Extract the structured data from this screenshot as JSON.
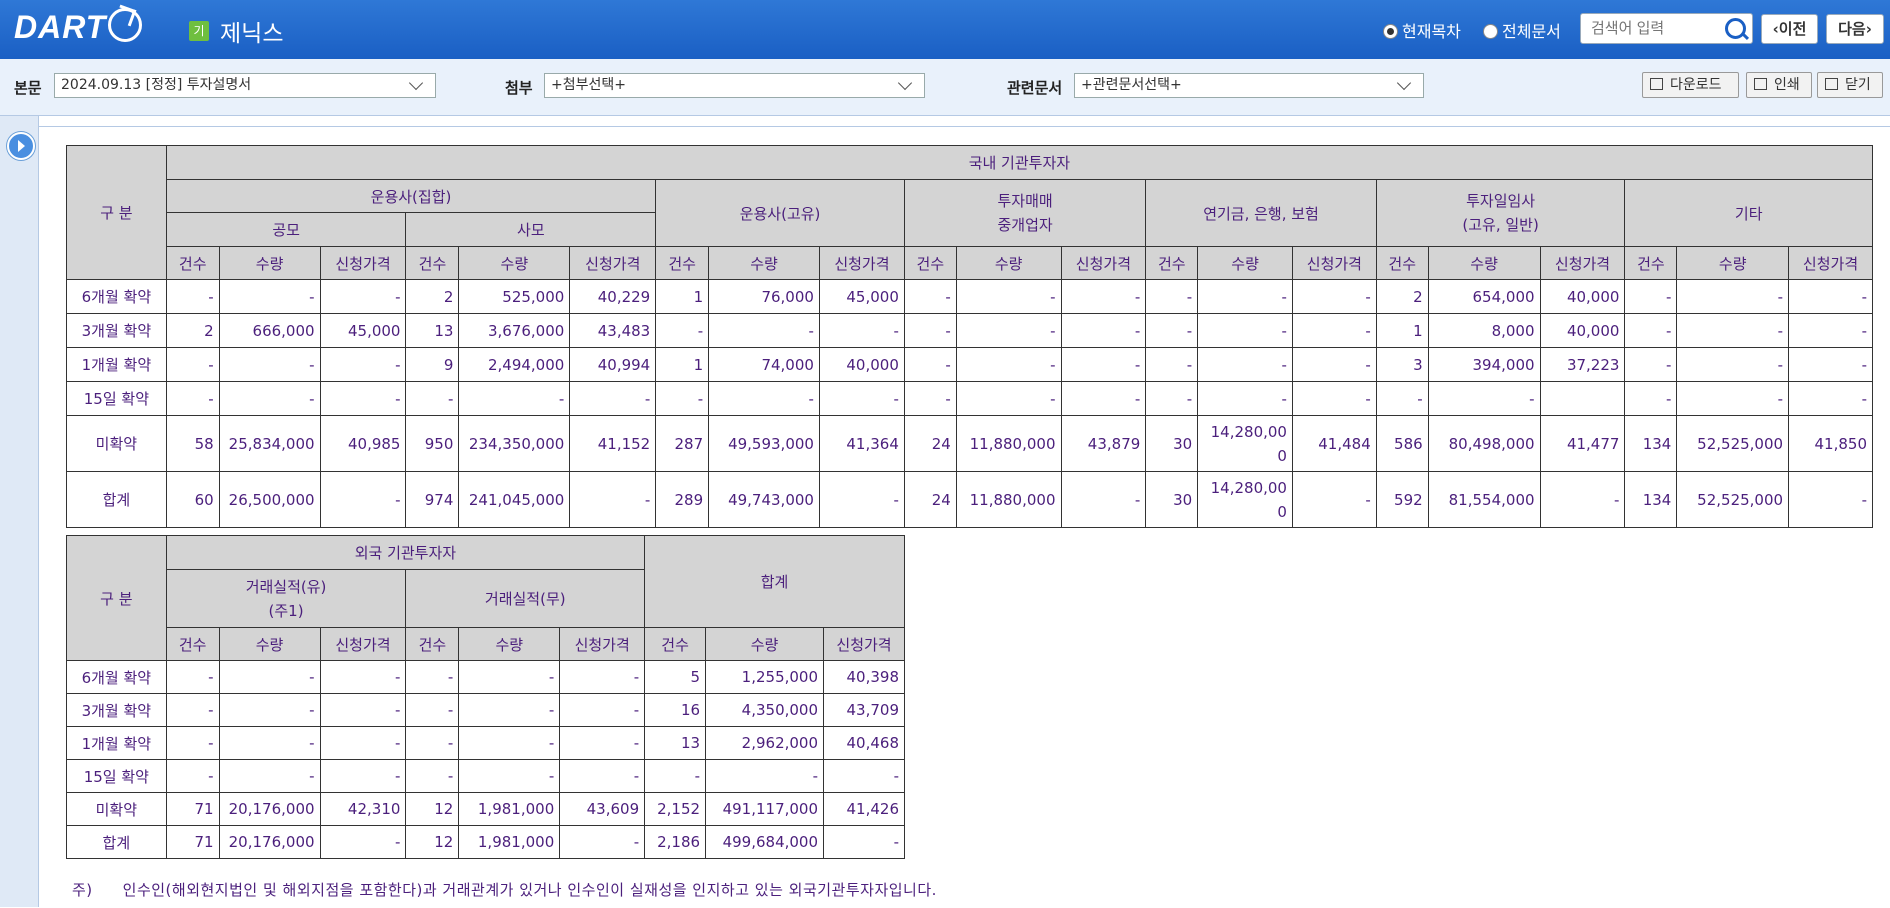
{
  "header": {
    "logo": "DART",
    "company_badge": "기",
    "company_name": "제닉스",
    "radio_current": "현재목차",
    "radio_all": "전체문서",
    "search_placeholder": "검색어 입력",
    "prev_label": "이전",
    "next_label": "다음"
  },
  "docbar": {
    "main_label": "본문",
    "main_value": "2024.09.13  [정정] 투자설명서",
    "attach_label": "첨부",
    "attach_value": "+첨부선택+",
    "related_label": "관련문서",
    "related_value": "+관련문서선택+",
    "download_label": "다운로드",
    "print_label": "인쇄",
    "close_label": "닫기"
  },
  "domestic": {
    "corner": "구 분",
    "group_title": "국내 기관투자자",
    "g1": "운용사(집합)",
    "g1a": "공모",
    "g1b": "사모",
    "g2": "운용사(고유)",
    "g3": "투자매매\n중개업자",
    "g4": "연기금, 은행, 보험",
    "g5": "투자일임사\n(고유, 일반)",
    "g6": "기타",
    "sub_cnt": "건수",
    "sub_qty": "수량",
    "sub_price": "신청가격",
    "rows": [
      {
        "label": "6개월 확약",
        "v": [
          "-",
          "-",
          "-",
          "2",
          "525,000",
          "40,229",
          "1",
          "76,000",
          "45,000",
          "-",
          "-",
          "-",
          "-",
          "-",
          "-",
          "2",
          "654,000",
          "40,000",
          "-",
          "-",
          "-"
        ]
      },
      {
        "label": "3개월 확약",
        "v": [
          "2",
          "666,000",
          "45,000",
          "13",
          "3,676,000",
          "43,483",
          "-",
          "-",
          "-",
          "-",
          "-",
          "-",
          "-",
          "-",
          "-",
          "1",
          "8,000",
          "40,000",
          "-",
          "-",
          "-"
        ]
      },
      {
        "label": "1개월 확약",
        "v": [
          "-",
          "-",
          "-",
          "9",
          "2,494,000",
          "40,994",
          "1",
          "74,000",
          "40,000",
          "-",
          "-",
          "-",
          "-",
          "-",
          "-",
          "3",
          "394,000",
          "37,223",
          "-",
          "-",
          "-"
        ]
      },
      {
        "label": "15일 확약",
        "v": [
          "-",
          "-",
          "-",
          "-",
          "-",
          "-",
          "-",
          "-",
          "-",
          "-",
          "-",
          "-",
          "-",
          "-",
          "-",
          "-",
          "-",
          "",
          "-",
          "-",
          "-"
        ]
      },
      {
        "label": "미확약",
        "v": [
          "58",
          "25,834,000",
          "40,985",
          "950",
          "234,350,000",
          "41,152",
          "287",
          "49,593,000",
          "41,364",
          "24",
          "11,880,000",
          "43,879",
          "30",
          "14,280,000",
          "41,484",
          "586",
          "80,498,000",
          "41,477",
          "134",
          "52,525,000",
          "41,850"
        ]
      },
      {
        "label": "합계",
        "v": [
          "60",
          "26,500,000",
          "-",
          "974",
          "241,045,000",
          "-",
          "289",
          "49,743,000",
          "-",
          "24",
          "11,880,000",
          "-",
          "30",
          "14,280,000",
          "-",
          "592",
          "81,554,000",
          "-",
          "134",
          "52,525,000",
          "-"
        ]
      }
    ]
  },
  "foreign": {
    "corner": "구 분",
    "group_title": "외국 기관투자자",
    "g1": "거래실적(유)\n(주1)",
    "g2": "거래실적(무)",
    "g3": "합계",
    "sub_cnt": "건수",
    "sub_qty": "수량",
    "sub_price": "신청가격",
    "rows": [
      {
        "label": "6개월 확약",
        "v": [
          "-",
          "-",
          "-",
          "-",
          "-",
          "-",
          "5",
          "1,255,000",
          "40,398"
        ]
      },
      {
        "label": "3개월 확약",
        "v": [
          "-",
          "-",
          "-",
          "-",
          "-",
          "-",
          "16",
          "4,350,000",
          "43,709"
        ]
      },
      {
        "label": "1개월 확약",
        "v": [
          "-",
          "-",
          "-",
          "-",
          "-",
          "-",
          "13",
          "2,962,000",
          "40,468"
        ]
      },
      {
        "label": "15일 확약",
        "v": [
          "-",
          "-",
          "-",
          "-",
          "-",
          "-",
          "-",
          "-",
          "-"
        ]
      },
      {
        "label": "미확약",
        "v": [
          "71",
          "20,176,000",
          "42,310",
          "12",
          "1,981,000",
          "43,609",
          "2,152",
          "491,117,000",
          "41,426"
        ]
      },
      {
        "label": "합계",
        "v": [
          "71",
          "20,176,000",
          "-",
          "12",
          "1,981,000",
          "-",
          "2,186",
          "499,684,000",
          "-"
        ]
      }
    ]
  },
  "note": {
    "mark": "주)",
    "text": "인수인(해외현지법인 및 해외지점을 포함한다)과 거래관계가 있거나 인수인이 실재성을 인지하고 있는 외국기관투자자입니다."
  }
}
